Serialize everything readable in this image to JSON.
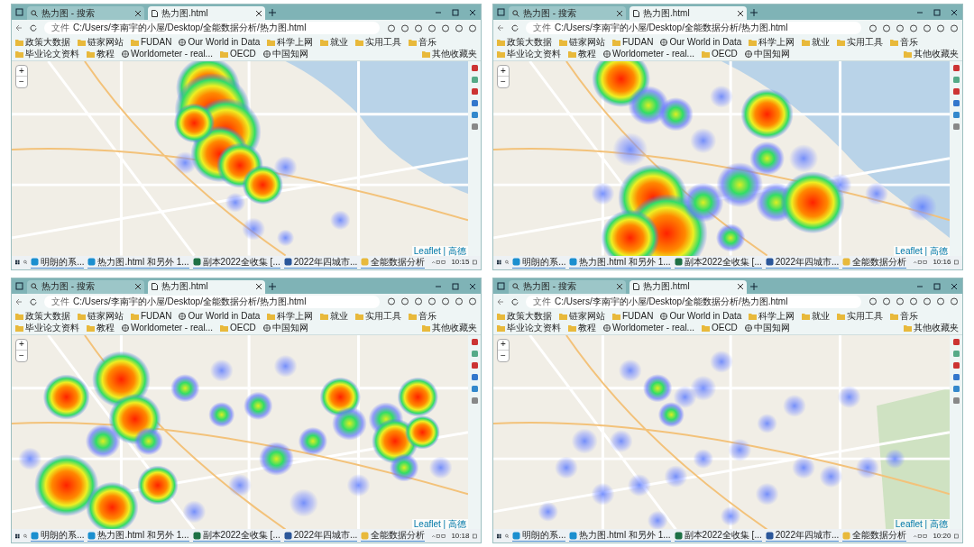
{
  "windows": [
    {
      "tabs": [
        {
          "label": "热力图 - 搜索",
          "kind": "search",
          "selected": false
        },
        {
          "label": "热力图.html",
          "kind": "page",
          "selected": true
        }
      ],
      "address": {
        "scheme": "文件",
        "url": "C:/Users/李南宇的小屋/Desktop/全能数据分析/热力图.html"
      },
      "bookmarks": [
        {
          "label": "政策大数据",
          "kind": "folder"
        },
        {
          "label": "链家网站",
          "kind": "folder"
        },
        {
          "label": "FUDAN",
          "kind": "folder"
        },
        {
          "label": "Our World in Data",
          "kind": "site"
        },
        {
          "label": "科学上网",
          "kind": "folder"
        },
        {
          "label": "就业",
          "kind": "folder"
        },
        {
          "label": "实用工具",
          "kind": "folder"
        },
        {
          "label": "音乐",
          "kind": "folder"
        },
        {
          "label": "毕业论文资料",
          "kind": "folder"
        },
        {
          "label": "教程",
          "kind": "folder"
        },
        {
          "label": "Worldometer - real...",
          "kind": "site"
        },
        {
          "label": "OECD",
          "kind": "folder"
        },
        {
          "label": "中国知网",
          "kind": "site"
        }
      ],
      "other_bookmarks": "其他收藏夹",
      "zoom_in": "+",
      "zoom_out": "−",
      "attribution": "Leaflet | 高德",
      "taskbar": {
        "apps": [
          {
            "label": "明朗的系...",
            "kind": "browser"
          },
          {
            "label": "热力图.html 和另外 1...",
            "kind": "browser"
          },
          {
            "label": "副本2022全收集 [...",
            "kind": "excel"
          },
          {
            "label": "2022年四城市...",
            "kind": "word"
          },
          {
            "label": "全能数据分析",
            "kind": "folder"
          }
        ],
        "time": "10:15"
      }
    },
    {
      "tabs": [
        {
          "label": "热力图 - 搜索",
          "kind": "search",
          "selected": false
        },
        {
          "label": "热力图.html",
          "kind": "page",
          "selected": true
        }
      ],
      "address": {
        "scheme": "文件",
        "url": "C:/Users/李南宇的小屋/Desktop/全能数据分析/热力图.html"
      },
      "bookmarks": [
        {
          "label": "政策大数据",
          "kind": "folder"
        },
        {
          "label": "链家网站",
          "kind": "folder"
        },
        {
          "label": "FUDAN",
          "kind": "folder"
        },
        {
          "label": "Our World in Data",
          "kind": "site"
        },
        {
          "label": "科学上网",
          "kind": "folder"
        },
        {
          "label": "就业",
          "kind": "folder"
        },
        {
          "label": "实用工具",
          "kind": "folder"
        },
        {
          "label": "音乐",
          "kind": "folder"
        },
        {
          "label": "毕业论文资料",
          "kind": "folder"
        },
        {
          "label": "教程",
          "kind": "folder"
        },
        {
          "label": "Worldometer - real...",
          "kind": "site"
        },
        {
          "label": "OECD",
          "kind": "folder"
        },
        {
          "label": "中国知网",
          "kind": "site"
        }
      ],
      "other_bookmarks": "其他收藏夹",
      "zoom_in": "+",
      "zoom_out": "−",
      "attribution": "Leaflet | 高德",
      "taskbar": {
        "apps": [
          {
            "label": "明朗的系...",
            "kind": "browser"
          },
          {
            "label": "热力图.html 和另外 1...",
            "kind": "browser"
          },
          {
            "label": "副本2022全收集 [...",
            "kind": "excel"
          },
          {
            "label": "2022年四城市...",
            "kind": "word"
          },
          {
            "label": "全能数据分析",
            "kind": "folder"
          }
        ],
        "time": "10:16"
      }
    },
    {
      "tabs": [
        {
          "label": "热力图 - 搜索",
          "kind": "search",
          "selected": false
        },
        {
          "label": "热力图.html",
          "kind": "page",
          "selected": true
        }
      ],
      "address": {
        "scheme": "文件",
        "url": "C:/Users/李南宇的小屋/Desktop/全能数据分析/热力图.html"
      },
      "bookmarks": [
        {
          "label": "政策大数据",
          "kind": "folder"
        },
        {
          "label": "链家网站",
          "kind": "folder"
        },
        {
          "label": "FUDAN",
          "kind": "folder"
        },
        {
          "label": "Our World in Data",
          "kind": "site"
        },
        {
          "label": "科学上网",
          "kind": "folder"
        },
        {
          "label": "就业",
          "kind": "folder"
        },
        {
          "label": "实用工具",
          "kind": "folder"
        },
        {
          "label": "音乐",
          "kind": "folder"
        },
        {
          "label": "毕业论文资料",
          "kind": "folder"
        },
        {
          "label": "教程",
          "kind": "folder"
        },
        {
          "label": "Worldometer - real...",
          "kind": "site"
        },
        {
          "label": "OECD",
          "kind": "folder"
        },
        {
          "label": "中国知网",
          "kind": "site"
        }
      ],
      "other_bookmarks": "其他收藏夹",
      "zoom_in": "+",
      "zoom_out": "−",
      "attribution": "Leaflet | 高德",
      "taskbar": {
        "apps": [
          {
            "label": "明朗的系...",
            "kind": "browser"
          },
          {
            "label": "热力图.html 和另外 1...",
            "kind": "browser"
          },
          {
            "label": "副本2022全收集 [...",
            "kind": "excel"
          },
          {
            "label": "2022年四城市...",
            "kind": "word"
          },
          {
            "label": "全能数据分析",
            "kind": "folder"
          }
        ],
        "time": "10:18"
      }
    },
    {
      "tabs": [
        {
          "label": "热力图 - 搜索",
          "kind": "search",
          "selected": false
        },
        {
          "label": "热力图.html",
          "kind": "page",
          "selected": true
        }
      ],
      "address": {
        "scheme": "文件",
        "url": "C:/Users/李南宇的小屋/Desktop/全能数据分析/热力图.html"
      },
      "bookmarks": [
        {
          "label": "政策大数据",
          "kind": "folder"
        },
        {
          "label": "链家网站",
          "kind": "folder"
        },
        {
          "label": "FUDAN",
          "kind": "folder"
        },
        {
          "label": "Our World in Data",
          "kind": "site"
        },
        {
          "label": "科学上网",
          "kind": "folder"
        },
        {
          "label": "就业",
          "kind": "folder"
        },
        {
          "label": "实用工具",
          "kind": "folder"
        },
        {
          "label": "音乐",
          "kind": "folder"
        },
        {
          "label": "毕业论文资料",
          "kind": "folder"
        },
        {
          "label": "教程",
          "kind": "folder"
        },
        {
          "label": "Worldometer - real...",
          "kind": "site"
        },
        {
          "label": "OECD",
          "kind": "folder"
        },
        {
          "label": "中国知网",
          "kind": "site"
        }
      ],
      "other_bookmarks": "其他收藏夹",
      "zoom_in": "+",
      "zoom_out": "−",
      "attribution": "Leaflet | 高德",
      "taskbar": {
        "apps": [
          {
            "label": "明朗的系...",
            "kind": "browser"
          },
          {
            "label": "热力图.html 和另外 1...",
            "kind": "browser"
          },
          {
            "label": "副本2022全收集 [...",
            "kind": "excel"
          },
          {
            "label": "2022年四城市...",
            "kind": "word"
          },
          {
            "label": "全能数据分析",
            "kind": "folder"
          }
        ],
        "time": "10:20"
      }
    }
  ]
}
